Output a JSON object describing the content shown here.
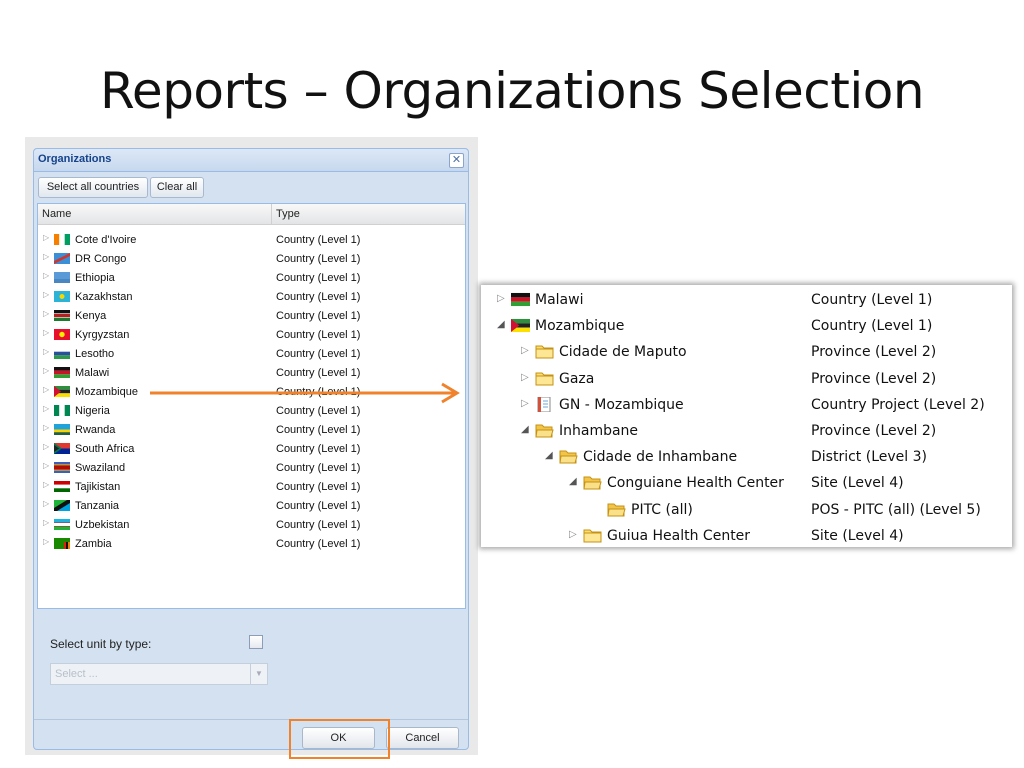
{
  "slide_title": "Reports – Organizations Selection",
  "dialog": {
    "title": "Organizations",
    "toolbar": {
      "select_all": "Select all countries",
      "clear_all": "Clear all"
    },
    "columns": {
      "name": "Name",
      "type": "Type"
    },
    "rows": [
      {
        "name": "Cote d'Ivoire",
        "type": "Country (Level 1)"
      },
      {
        "name": "DR Congo",
        "type": "Country (Level 1)"
      },
      {
        "name": "Ethiopia",
        "type": "Country (Level 1)"
      },
      {
        "name": "Kazakhstan",
        "type": "Country (Level 1)"
      },
      {
        "name": "Kenya",
        "type": "Country (Level 1)"
      },
      {
        "name": "Kyrgyzstan",
        "type": "Country (Level 1)"
      },
      {
        "name": "Lesotho",
        "type": "Country (Level 1)"
      },
      {
        "name": "Malawi",
        "type": "Country (Level 1)"
      },
      {
        "name": "Mozambique",
        "type": "Country (Level 1)"
      },
      {
        "name": "Nigeria",
        "type": "Country (Level 1)"
      },
      {
        "name": "Rwanda",
        "type": "Country (Level 1)"
      },
      {
        "name": "South Africa",
        "type": "Country (Level 1)"
      },
      {
        "name": "Swaziland",
        "type": "Country (Level 1)"
      },
      {
        "name": "Tajikistan",
        "type": "Country (Level 1)"
      },
      {
        "name": "Tanzania",
        "type": "Country (Level 1)"
      },
      {
        "name": "Uzbekistan",
        "type": "Country (Level 1)"
      },
      {
        "name": "Zambia",
        "type": "Country (Level 1)"
      }
    ],
    "select_unit_label": "Select unit by type:",
    "select_placeholder": "Select ...",
    "ok_label": "OK",
    "cancel_label": "Cancel"
  },
  "zoom": {
    "rows": [
      {
        "name": "Malawi",
        "type": "Country (Level 1)",
        "icon": "flag-icon",
        "state": "collapsed"
      },
      {
        "name": "Mozambique",
        "type": "Country (Level 1)",
        "icon": "flag-icon",
        "state": "expanded"
      },
      {
        "name": "Cidade de Maputo",
        "type": "Province (Level 2)",
        "icon": "folder-icon",
        "state": "collapsed"
      },
      {
        "name": "Gaza",
        "type": "Province (Level 2)",
        "icon": "folder-icon",
        "state": "collapsed"
      },
      {
        "name": "GN - Mozambique",
        "type": "Country Project (Level 2)",
        "icon": "document-icon",
        "state": "collapsed"
      },
      {
        "name": "Inhambane",
        "type": "Province (Level 2)",
        "icon": "open-folder-icon",
        "state": "expanded"
      },
      {
        "name": "Cidade de Inhambane",
        "type": "District (Level 3)",
        "icon": "open-folder-icon",
        "state": "expanded"
      },
      {
        "name": "Conguiane Health Center",
        "type": "Site (Level 4)",
        "icon": "open-folder-icon",
        "state": "expanded"
      },
      {
        "name": "PITC (all)",
        "type": "POS - PITC (all) (Level 5)",
        "icon": "open-folder-icon",
        "state": "leaf"
      },
      {
        "name": "Guiua Health Center",
        "type": "Site (Level 4)",
        "icon": "folder-icon",
        "state": "collapsed"
      }
    ]
  },
  "colors": {
    "accent_orange": "#f0822c",
    "panel_blue": "#d3e1f1",
    "title_blue": "#15428b"
  }
}
